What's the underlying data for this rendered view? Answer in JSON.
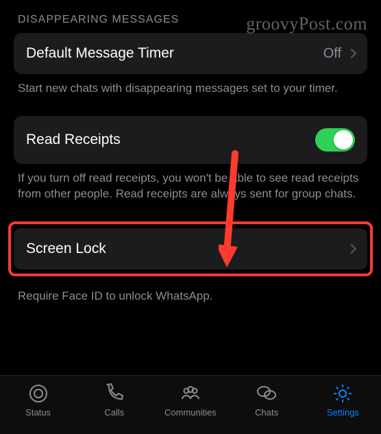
{
  "watermark": "groovyPost.com",
  "disappearing_section": {
    "header": "DISAPPEARING MESSAGES",
    "timer_label": "Default Message Timer",
    "timer_value": "Off",
    "footer": "Start new chats with disappearing messages set to your timer."
  },
  "read_receipts": {
    "label": "Read Receipts",
    "enabled": true,
    "footer": "If you turn off read receipts, you won't be able to see read receipts from other people. Read receipts are always sent for group chats."
  },
  "screen_lock": {
    "label": "Screen Lock",
    "footer": "Require Face ID to unlock WhatsApp."
  },
  "tabs": {
    "status": "Status",
    "calls": "Calls",
    "communities": "Communities",
    "chats": "Chats",
    "settings": "Settings"
  }
}
